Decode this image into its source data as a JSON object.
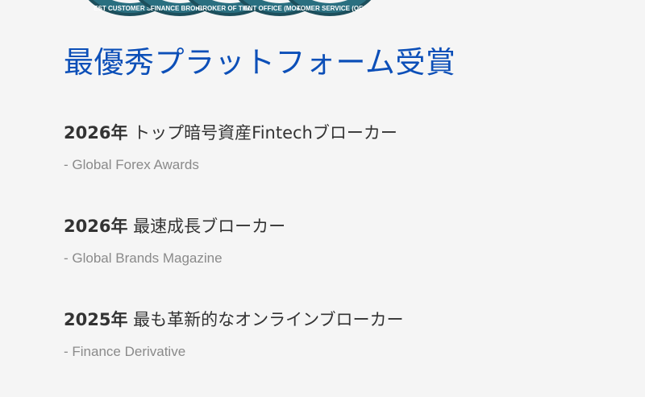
{
  "badges": [
    {
      "ring_text": "EST CUSTOMER SERVI",
      "name": "badge-1"
    },
    {
      "ring_text": "FINANCE BROKER",
      "name": "badge-2"
    },
    {
      "ring_text": "BROKER OF THE YE",
      "name": "badge-3"
    },
    {
      "ring_text": "ENT OFFICE (MORE TH",
      "name": "badge-4"
    },
    {
      "ring_text": "TOMER SERVICE (OF",
      "name": "badge-5"
    }
  ],
  "badge_colors": {
    "ring": "#1d4f5c",
    "band": "#2a6f80",
    "text": "#ffffff"
  },
  "title": "最優秀プラットフォーム受賞",
  "title_color": "#0c4fb8",
  "awards": [
    {
      "year": "2026年",
      "name": "トップ暗号資産Fintechブローカー",
      "source": "- Global Forex Awards"
    },
    {
      "year": "2026年",
      "name": "最速成長ブローカー",
      "source": "- Global Brands Magazine"
    },
    {
      "year": "2025年",
      "name": "最も革新的なオンラインブローカー",
      "source": "- Finance Derivative"
    }
  ]
}
